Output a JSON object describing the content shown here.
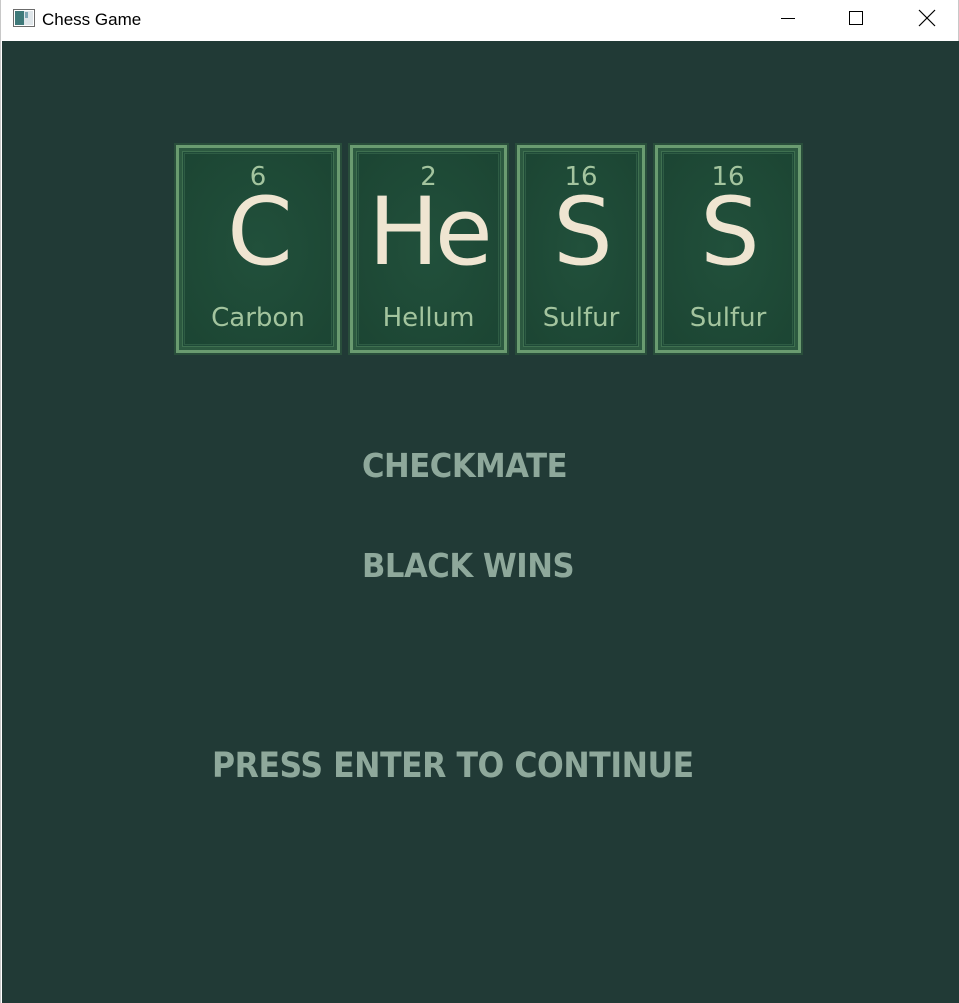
{
  "window": {
    "title": "Chess Game",
    "icon": "app-window-icon",
    "controls": {
      "minimize_icon": "minimize-icon",
      "maximize_icon": "maximize-icon",
      "close_icon": "close-icon"
    }
  },
  "logo": {
    "tiles": [
      {
        "number": "6",
        "symbol": "C",
        "name": "Carbon"
      },
      {
        "number": "2",
        "symbol": "He",
        "name": "Hellum"
      },
      {
        "number": "16",
        "symbol": "S",
        "name": "Sulfur"
      },
      {
        "number": "16",
        "symbol": "S",
        "name": "Sulfur"
      }
    ]
  },
  "game_over": {
    "status": "CHECKMATE",
    "result": "BLACK WINS",
    "prompt": "PRESS ENTER TO CONTINUE"
  },
  "colors": {
    "background": "#213a36",
    "tile_fill": "#1f4a38",
    "tile_border": "#6a9b70",
    "symbol_text": "#efe5d1",
    "tile_label_text": "#a3c49e",
    "message_text": "#8ea89b"
  }
}
